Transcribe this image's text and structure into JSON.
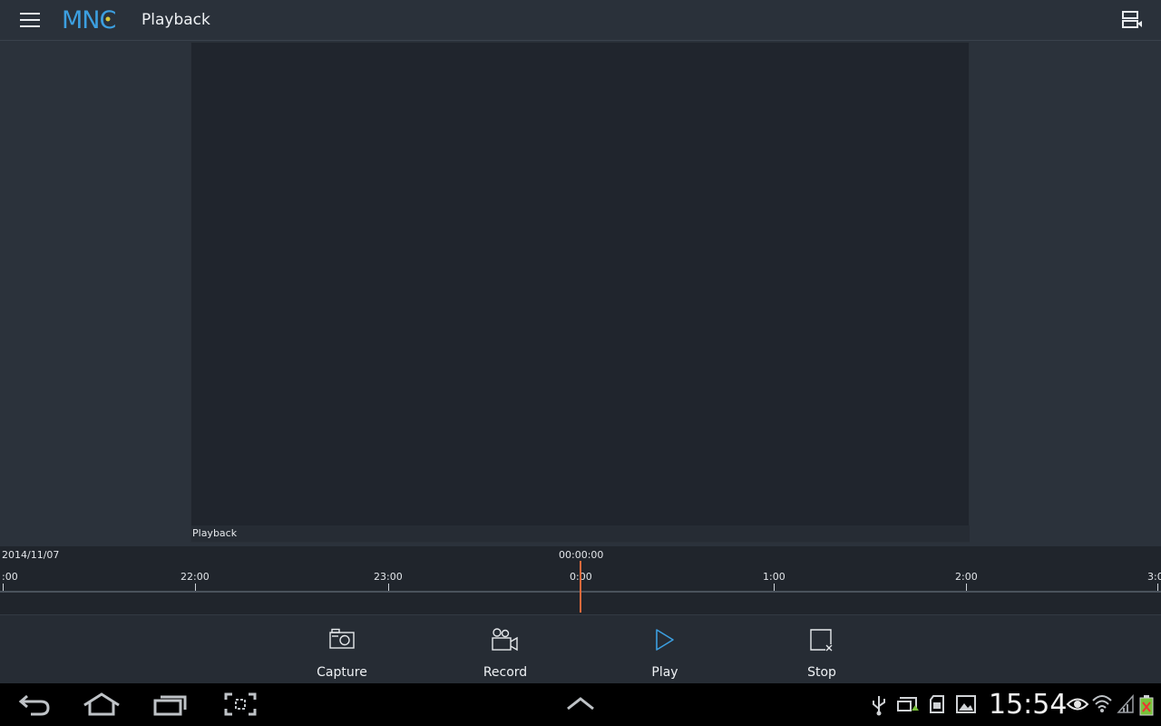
{
  "app": {
    "logo_text": "MNC",
    "title": "Playback",
    "accent_color": "#3c9fe0"
  },
  "icons": {
    "menu": "hamburger-menu-icon",
    "layout": "camera-list-icon"
  },
  "video": {
    "caption": "Playback"
  },
  "timeline": {
    "date": "2014/11/07",
    "cursor_time": "00:00:00",
    "cursor_color": "#e56a3c",
    "labels": [
      ":00",
      "22:00",
      "23:00",
      "0:00",
      "1:00",
      "2:00",
      "3:0"
    ]
  },
  "controls": [
    {
      "id": "capture",
      "label": "Capture",
      "icon": "camera-icon"
    },
    {
      "id": "record",
      "label": "Record",
      "icon": "video-camera-icon"
    },
    {
      "id": "play",
      "label": "Play",
      "icon": "play-icon",
      "color": "#3c9fe0"
    },
    {
      "id": "stop",
      "label": "Stop",
      "icon": "stop-icon"
    }
  ],
  "system_bar": {
    "clock": "15:54",
    "nav_icons": [
      "back-icon",
      "home-icon",
      "recent-apps-icon",
      "screenshot-icon",
      "chevron-up-icon"
    ],
    "status_icons": [
      "usb-icon",
      "screen-mirror-icon",
      "sd-card-icon",
      "gallery-icon",
      "eye-icon",
      "wifi-icon",
      "signal-icon",
      "battery-icon"
    ]
  }
}
